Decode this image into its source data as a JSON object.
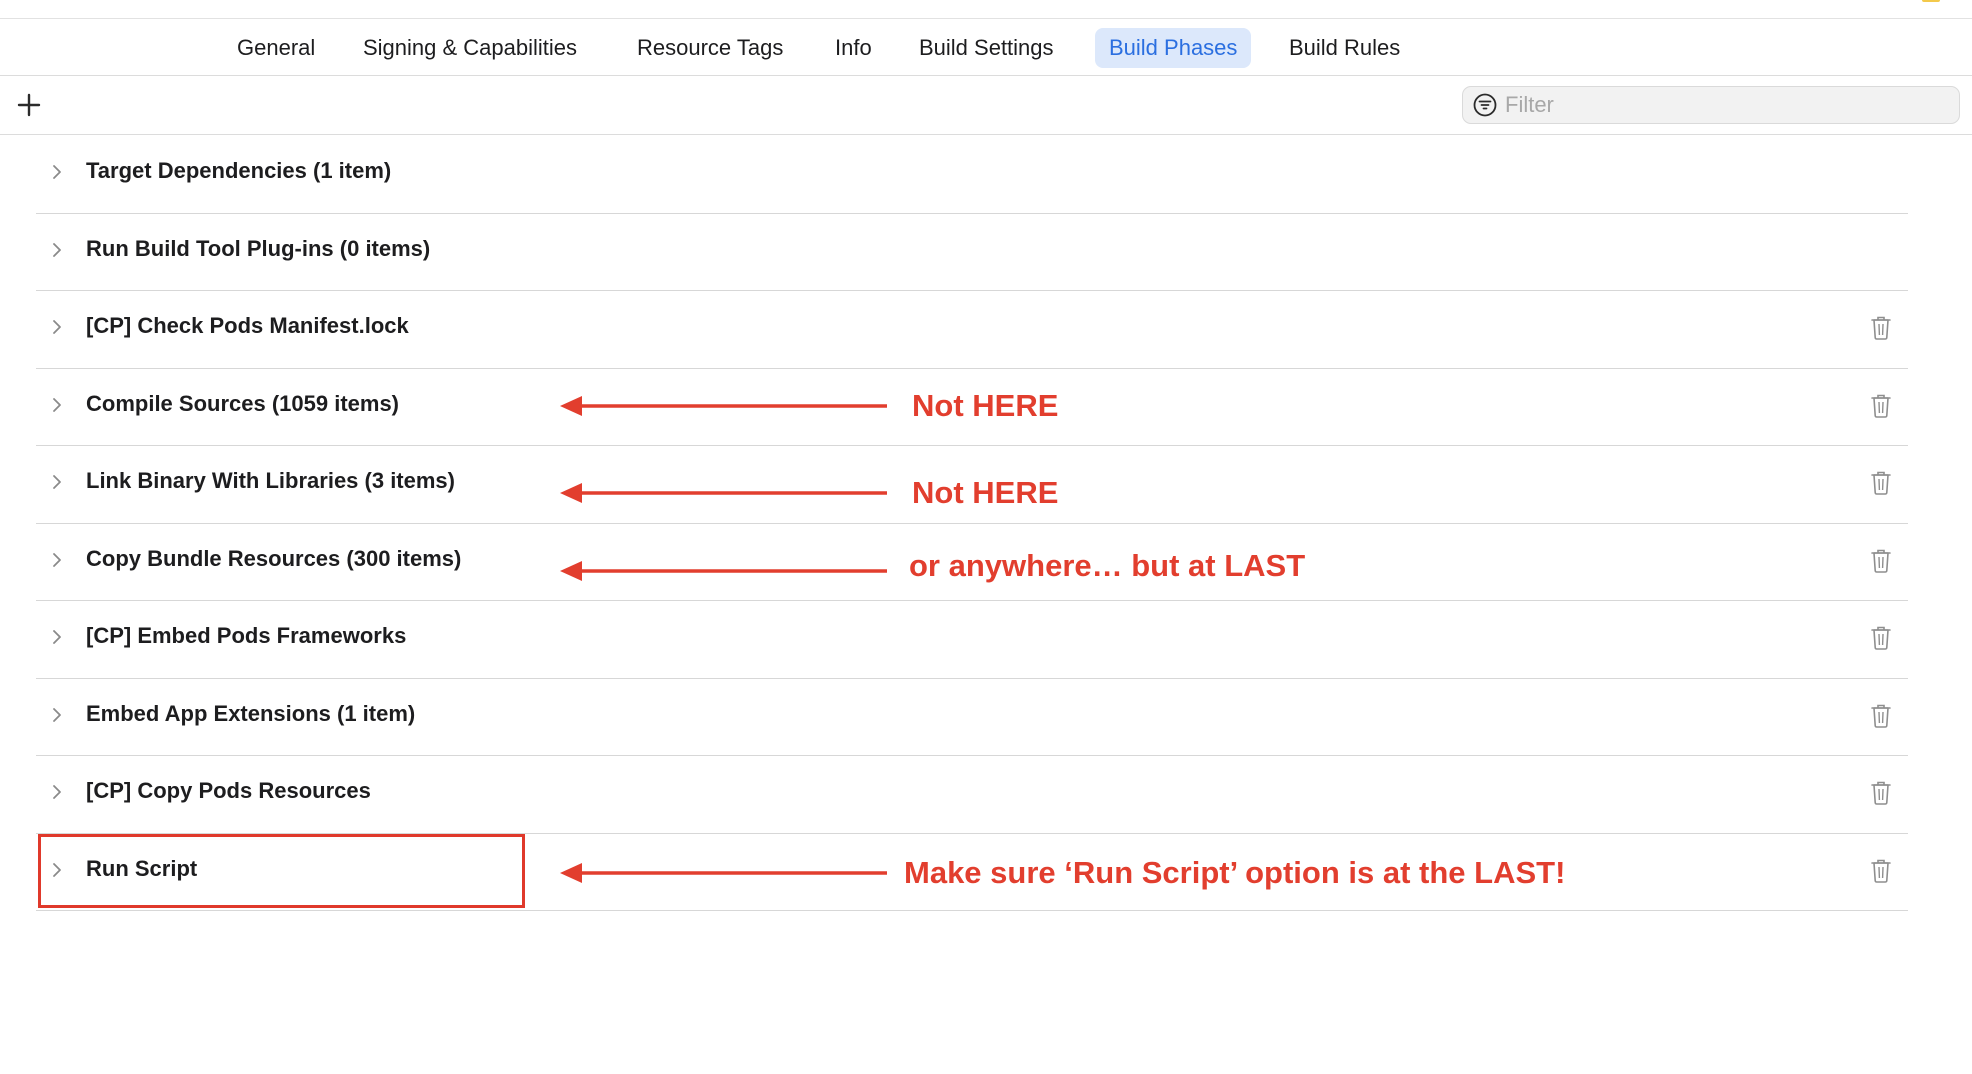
{
  "tabs": [
    {
      "label": "General",
      "active": false
    },
    {
      "label": "Signing & Capabilities",
      "active": false
    },
    {
      "label": "Resource Tags",
      "active": false
    },
    {
      "label": "Info",
      "active": false
    },
    {
      "label": "Build Settings",
      "active": false
    },
    {
      "label": "Build Phases",
      "active": true
    },
    {
      "label": "Build Rules",
      "active": false
    }
  ],
  "toolbar": {
    "add_icon": "plus-icon",
    "filter_icon": "filter-icon",
    "filter_placeholder": "Filter",
    "filter_value": ""
  },
  "phases": [
    {
      "label": "Target Dependencies (1 item)",
      "deletable": false
    },
    {
      "label": "Run Build Tool Plug-ins (0 items)",
      "deletable": false
    },
    {
      "label": "[CP] Check Pods Manifest.lock",
      "deletable": true
    },
    {
      "label": "Compile Sources (1059 items)",
      "deletable": true
    },
    {
      "label": "Link Binary With Libraries (3 items)",
      "deletable": true
    },
    {
      "label": "Copy Bundle Resources (300 items)",
      "deletable": true
    },
    {
      "label": "[CP] Embed Pods Frameworks",
      "deletable": true
    },
    {
      "label": "Embed App Extensions (1 item)",
      "deletable": true
    },
    {
      "label": "[CP] Copy Pods Resources",
      "deletable": true
    },
    {
      "label": "Run Script",
      "deletable": true
    }
  ],
  "annotations": {
    "compile_sources": "Not HERE",
    "link_binary": "Not HERE",
    "copy_bundle": "or anywhere… but at LAST",
    "run_script": "Make sure ‘Run Script’ option is at the LAST!"
  },
  "colors": {
    "accent": "#2b6fe0",
    "tab_active_bg": "#dce8fb",
    "annotation_red": "#e23e2e",
    "separator": "#d7d7d7"
  }
}
